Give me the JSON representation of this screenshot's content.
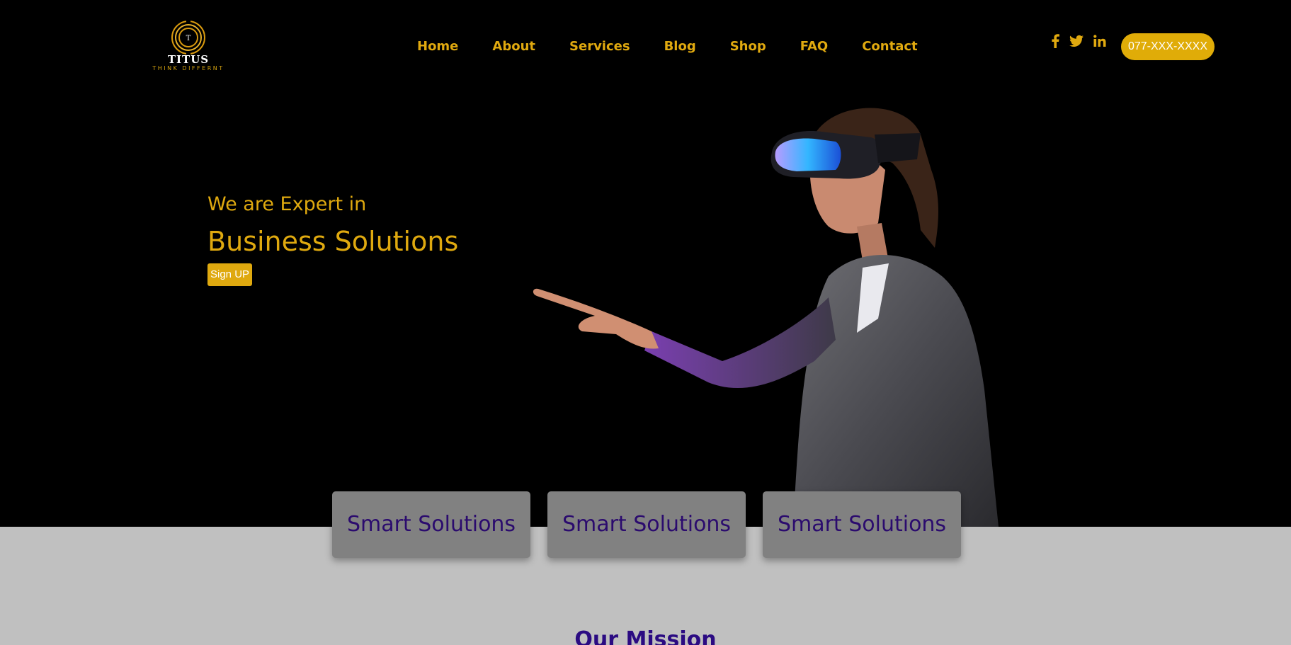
{
  "header": {
    "logo": {
      "name": "TITUS",
      "tagline": "THINK DIFFERNT",
      "emblem_letter": "T"
    },
    "nav": [
      "Home",
      "About",
      "Services",
      "Blog",
      "Shop",
      "FAQ",
      "Contact"
    ],
    "social_icons": [
      "facebook-icon",
      "twitter-icon",
      "linkedin-icon"
    ],
    "phone_button": "077-XXX-XXXX"
  },
  "hero": {
    "subtitle": "We are Expert in",
    "title": "Business Solutions",
    "cta": "Sign UP"
  },
  "cards": [
    "Smart Solutions",
    "Smart Solutions",
    "Smart Solutions"
  ],
  "mission": {
    "heading": "Our Mission"
  },
  "colors": {
    "accent": "#e0ac08",
    "dark_bg": "#000000",
    "light_bg": "#c0c0c0",
    "card_bg": "#818181",
    "card_text": "#2b0b6e"
  }
}
